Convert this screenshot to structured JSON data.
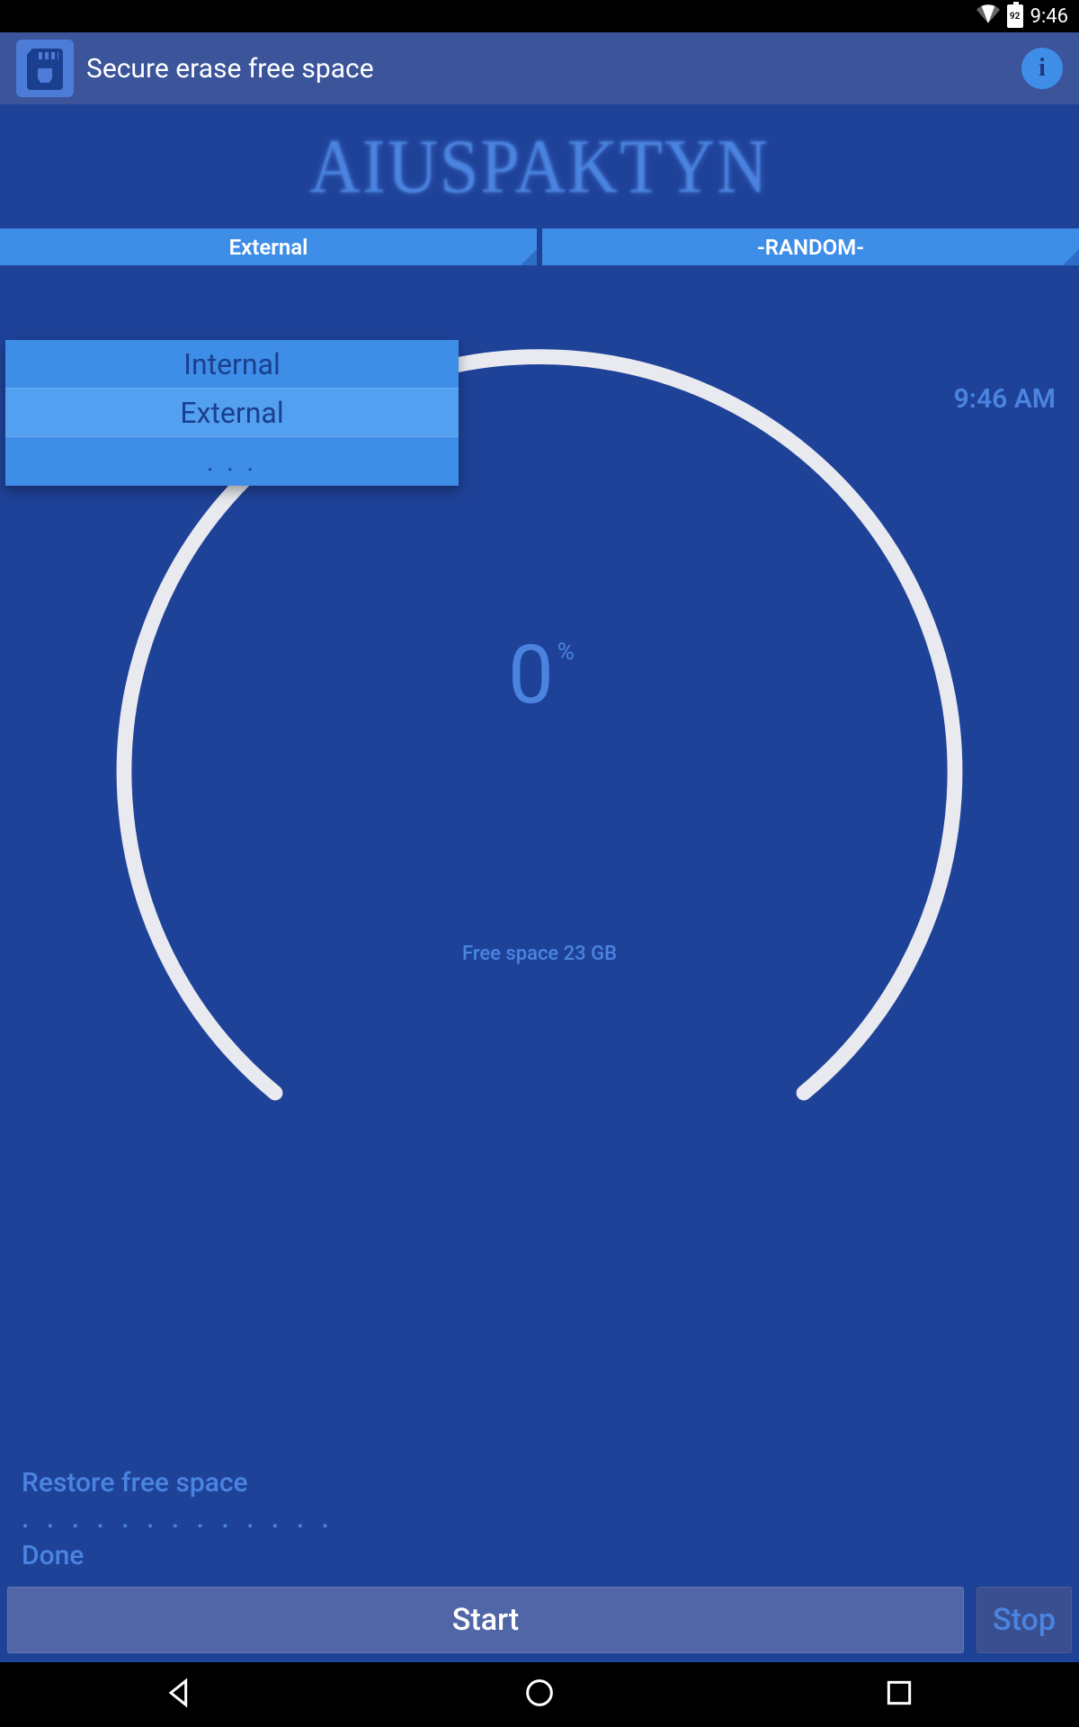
{
  "status": {
    "time": "9:46",
    "battery": "92"
  },
  "appbar": {
    "title": "Secure erase free space"
  },
  "banner": {
    "text": "AIUSPAKTYN"
  },
  "spinners": {
    "left": "External",
    "right": "-RANDOM-"
  },
  "dropdown": {
    "items": [
      "Internal",
      "External",
      ". . ."
    ],
    "selected_index": 1
  },
  "time_label": "9:46 AM",
  "gauge": {
    "value": "0",
    "unit": "%",
    "free_space": "Free space 23 GB"
  },
  "log": {
    "line1": "Restore free space",
    "dots": ". . . . . . . . . . . . .",
    "line2": "Done"
  },
  "buttons": {
    "start": "Start",
    "stop": "Stop"
  }
}
